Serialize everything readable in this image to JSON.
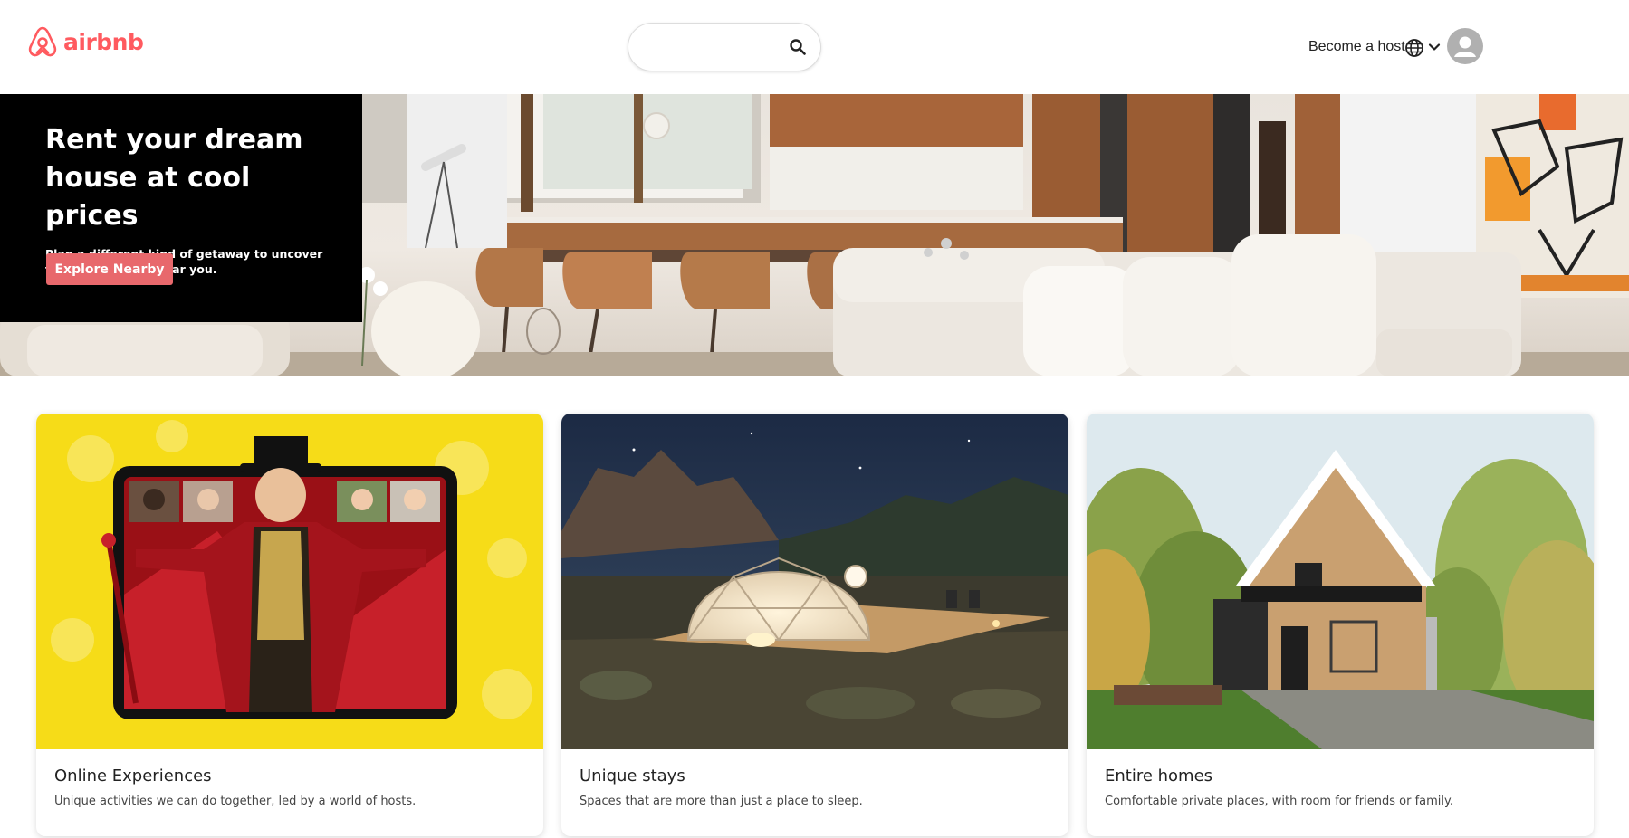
{
  "brand": {
    "name": "airbnb",
    "color": "#ff5a5f"
  },
  "header": {
    "search": {
      "value": "",
      "placeholder": "",
      "icon": "search-icon"
    },
    "host_link": "Become a host",
    "globe_icon": "globe-icon",
    "menu_icon": "chevron-down-icon",
    "avatar_icon": "user-avatar-icon"
  },
  "hero": {
    "title": "Rent your dream house at cool prices",
    "subtitle": "Plan a different kind of getaway to uncover the hidden gems near you.",
    "button_label": "Explore Nearby",
    "button_color": "#e8686c"
  },
  "cards": [
    {
      "title": "Online Experiences",
      "description": "Unique activities we can do together, led by a world of hosts."
    },
    {
      "title": "Unique stays",
      "description": "Spaces that are more than just a place to sleep."
    },
    {
      "title": "Entire homes",
      "description": "Comfortable private places, with room for friends or family."
    }
  ]
}
